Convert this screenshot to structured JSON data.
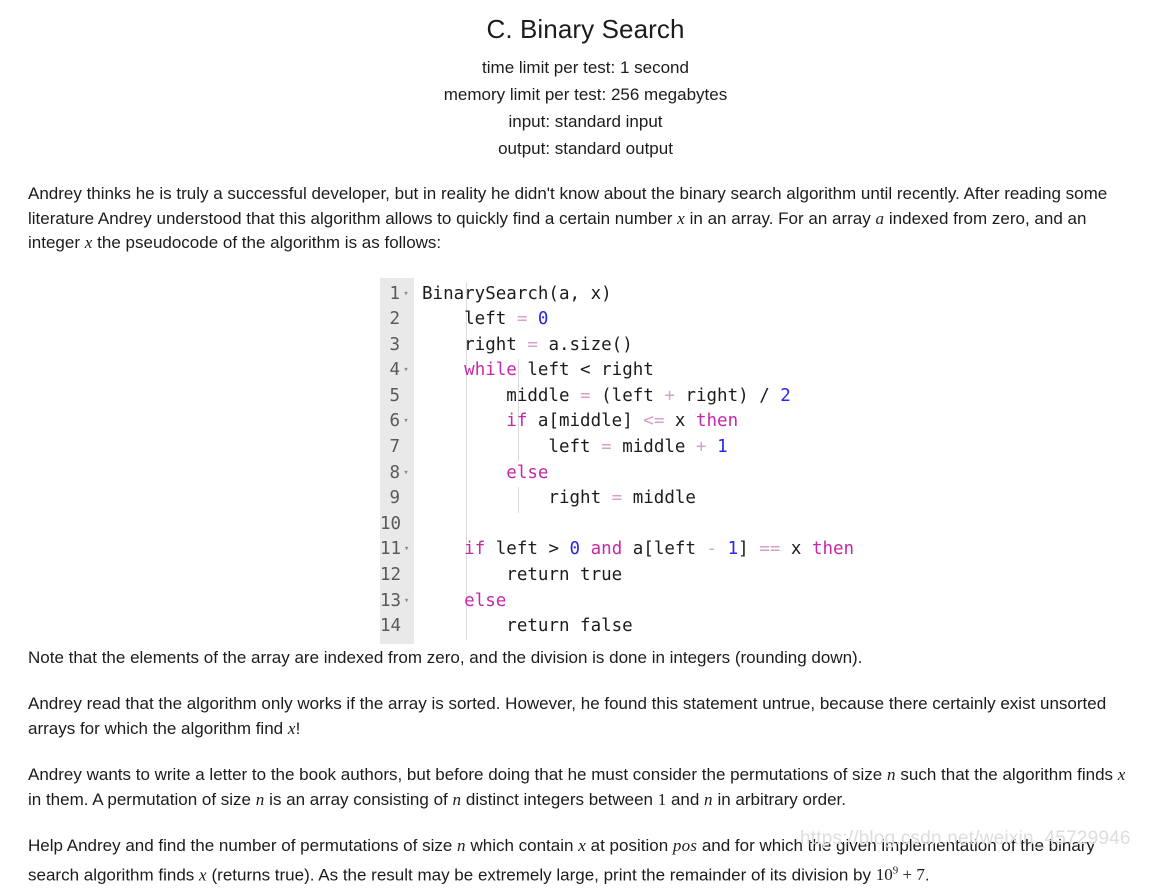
{
  "header": {
    "title": "C. Binary Search",
    "time_limit": "time limit per test: 1 second",
    "memory_limit": "memory limit per test: 256 megabytes",
    "input": "input: standard input",
    "output": "output: standard output"
  },
  "paragraphs": {
    "intro_a": "Andrey thinks he is truly a successful developer, but in reality he didn't know about the binary search algorithm until recently. After reading some literature Andrey understood that this algorithm allows to quickly find a certain number ",
    "intro_b": " in an array. For an array ",
    "intro_c": " indexed from zero, and an integer ",
    "intro_d": " the pseudocode of the algorithm is as follows:",
    "note": "Note that the elements of the array are indexed from zero, and the division is done in integers (rounding down).",
    "unsorted_a": "Andrey read that the algorithm only works if the array is sorted. However, he found this statement untrue, because there certainly exist unsorted arrays for which the algorithm find ",
    "unsorted_b": "!",
    "letter_a": "Andrey wants to write a letter to the book authors, but before doing that he must consider the permutations of size ",
    "letter_b": " such that the algorithm finds ",
    "letter_c": " in them. A permutation of size ",
    "letter_d": " is an array consisting of ",
    "letter_e": " distinct integers between ",
    "letter_f": " and ",
    "letter_g": " in arbitrary order.",
    "help_a": "Help Andrey and find the number of permutations of size ",
    "help_b": " which contain ",
    "help_c": " at position ",
    "help_d": " and for which the given implementation of the binary search algorithm finds ",
    "help_e": " (returns true). As the result may be extremely large, print the remainder of its division by ",
    "help_f": "."
  },
  "math": {
    "x": "x",
    "a": "a",
    "n": "n",
    "pos": "pos",
    "one": "1",
    "ten": "10",
    "nine": "9",
    "plus_seven": " + 7"
  },
  "code": {
    "lines": [
      {
        "n": "1",
        "fold": true,
        "tokens": [
          {
            "t": "BinarySearch(a, x)",
            "c": "pl"
          }
        ]
      },
      {
        "n": "2",
        "fold": false,
        "tokens": [
          {
            "t": "    left ",
            "c": "pl"
          },
          {
            "t": "=",
            "c": "op"
          },
          {
            "t": " ",
            "c": "pl"
          },
          {
            "t": "0",
            "c": "num0"
          }
        ]
      },
      {
        "n": "3",
        "fold": false,
        "tokens": [
          {
            "t": "    right ",
            "c": "pl"
          },
          {
            "t": "=",
            "c": "op"
          },
          {
            "t": " a.size()",
            "c": "pl"
          }
        ]
      },
      {
        "n": "4",
        "fold": true,
        "tokens": [
          {
            "t": "    ",
            "c": "pl"
          },
          {
            "t": "while",
            "c": "kw"
          },
          {
            "t": " left < right",
            "c": "pl"
          }
        ]
      },
      {
        "n": "5",
        "fold": false,
        "tokens": [
          {
            "t": "        middle ",
            "c": "pl"
          },
          {
            "t": "=",
            "c": "op"
          },
          {
            "t": " (left ",
            "c": "pl"
          },
          {
            "t": "+",
            "c": "op"
          },
          {
            "t": " right) / ",
            "c": "pl"
          },
          {
            "t": "2",
            "c": "num0"
          }
        ]
      },
      {
        "n": "6",
        "fold": true,
        "tokens": [
          {
            "t": "        ",
            "c": "pl"
          },
          {
            "t": "if",
            "c": "kw"
          },
          {
            "t": " a[middle] ",
            "c": "pl"
          },
          {
            "t": "<=",
            "c": "op"
          },
          {
            "t": " x ",
            "c": "pl"
          },
          {
            "t": "then",
            "c": "kw"
          }
        ]
      },
      {
        "n": "7",
        "fold": false,
        "tokens": [
          {
            "t": "            left ",
            "c": "pl"
          },
          {
            "t": "=",
            "c": "op"
          },
          {
            "t": " middle ",
            "c": "pl"
          },
          {
            "t": "+",
            "c": "op"
          },
          {
            "t": " ",
            "c": "pl"
          },
          {
            "t": "1",
            "c": "num0"
          }
        ]
      },
      {
        "n": "8",
        "fold": true,
        "tokens": [
          {
            "t": "        ",
            "c": "pl"
          },
          {
            "t": "else",
            "c": "kw"
          }
        ]
      },
      {
        "n": "9",
        "fold": false,
        "tokens": [
          {
            "t": "            right ",
            "c": "pl"
          },
          {
            "t": "=",
            "c": "op"
          },
          {
            "t": " middle",
            "c": "pl"
          }
        ]
      },
      {
        "n": "10",
        "fold": false,
        "tokens": [
          {
            "t": "",
            "c": "pl"
          }
        ]
      },
      {
        "n": "11",
        "fold": true,
        "tokens": [
          {
            "t": "    ",
            "c": "pl"
          },
          {
            "t": "if",
            "c": "kw"
          },
          {
            "t": " left > ",
            "c": "pl"
          },
          {
            "t": "0",
            "c": "num0"
          },
          {
            "t": " ",
            "c": "pl"
          },
          {
            "t": "and",
            "c": "kw"
          },
          {
            "t": " a[left ",
            "c": "pl"
          },
          {
            "t": "-",
            "c": "op"
          },
          {
            "t": " ",
            "c": "pl"
          },
          {
            "t": "1",
            "c": "num0"
          },
          {
            "t": "] ",
            "c": "pl"
          },
          {
            "t": "==",
            "c": "op"
          },
          {
            "t": " x ",
            "c": "pl"
          },
          {
            "t": "then",
            "c": "kw"
          }
        ]
      },
      {
        "n": "12",
        "fold": false,
        "tokens": [
          {
            "t": "        return true",
            "c": "pl"
          }
        ]
      },
      {
        "n": "13",
        "fold": true,
        "tokens": [
          {
            "t": "    ",
            "c": "pl"
          },
          {
            "t": "else",
            "c": "kw"
          }
        ]
      },
      {
        "n": "14",
        "fold": false,
        "tokens": [
          {
            "t": "        return false",
            "c": "pl"
          }
        ]
      }
    ],
    "fold_glyph": "▾"
  },
  "watermark": {
    "text": "https://blog.csdn.net/weixin_45729946"
  },
  "colors": {
    "keyword": "#c629a8",
    "number": "#2727e6",
    "operator": "#d8a0c8",
    "plain": "#1c1c1c",
    "gutter_bg": "#e9e9e9",
    "gutter_fg": "#5a5a5a",
    "watermark": "#dddddd"
  }
}
